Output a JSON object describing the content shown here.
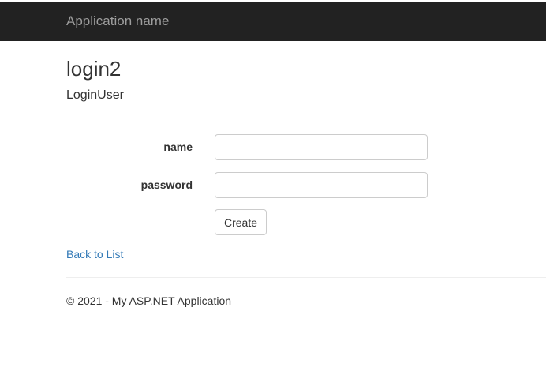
{
  "navbar": {
    "brand": "Application name"
  },
  "page": {
    "title": "login2",
    "subtitle": "LoginUser"
  },
  "form": {
    "name_label": "name",
    "name_value": "",
    "password_label": "password",
    "password_value": "",
    "submit_label": "Create"
  },
  "links": {
    "back_to_list": "Back to List"
  },
  "footer": {
    "text": "© 2021 - My ASP.NET Application"
  }
}
